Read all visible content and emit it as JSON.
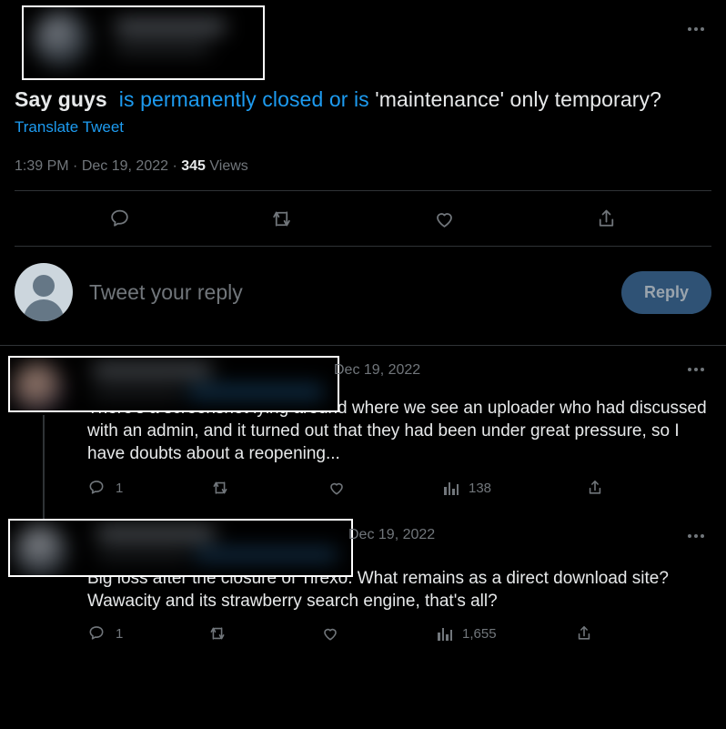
{
  "theme": {
    "background": "#000000",
    "text_primary": "#e7e9ea",
    "text_secondary": "#71767b",
    "link_blue": "#1d9bf0",
    "separator": "#2f3336",
    "reply_button_bg": "#2f5275",
    "reply_button_text": "#9aa4ad"
  },
  "main_tweet": {
    "more_icon": "more-horizontal-icon",
    "author_redacted": true,
    "text_part_1": "Say guys",
    "text_link": "is permanently closed or is",
    "text_part_2": "'maintenance' only temporary?",
    "translate_label": "Translate Tweet",
    "time": "1:39 PM",
    "dot_1": "·",
    "date": "Dec 19, 2022",
    "dot_2": "·",
    "views_count": "345",
    "views_label": "Views",
    "actions": [
      {
        "name": "reply-icon",
        "label": ""
      },
      {
        "name": "retweet-icon",
        "label": ""
      },
      {
        "name": "like-icon",
        "label": ""
      },
      {
        "name": "share-icon",
        "label": ""
      }
    ]
  },
  "composer": {
    "avatar_icon": "default-avatar-icon",
    "placeholder": "Tweet your reply",
    "reply_button_label": "Reply"
  },
  "replies": [
    {
      "author_redacted": true,
      "date": "Dec 19, 2022",
      "more_icon": "more-horizontal-icon",
      "text": "There's a screenshot lying around where we see an uploader who had discussed with an admin, and it turned out that they had been under great pressure, so I have doubts about a reopening...",
      "reply_count": "1",
      "retweet_count": "",
      "like_count": "",
      "views_count": "138"
    },
    {
      "author_redacted": true,
      "date": "Dec 19, 2022",
      "more_icon": "more-horizontal-icon",
      "text": "Big loss after the closure of Tirexo. What remains as a direct download site? Wawacity and its strawberry search engine, that's all?",
      "reply_count": "1",
      "retweet_count": "",
      "like_count": "",
      "views_count": "1,655"
    }
  ]
}
